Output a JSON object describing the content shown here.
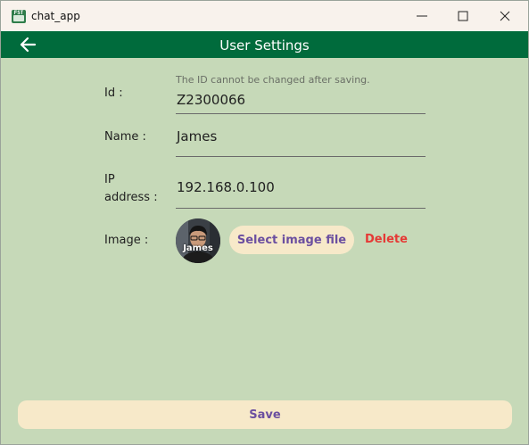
{
  "window": {
    "title": "chat_app",
    "app_icon_text": "FST"
  },
  "appbar": {
    "title": "User Settings",
    "back_icon": "arrow-left-icon"
  },
  "form": {
    "id": {
      "label": "Id :",
      "helper": "The ID cannot be changed after saving.",
      "value": "Z2300066"
    },
    "name": {
      "label": "Name :",
      "value": "James"
    },
    "ip": {
      "label_line1": "IP",
      "label_line2": "address :",
      "value": "192.168.0.100"
    },
    "image": {
      "label": "Image :",
      "avatar_caption": "James",
      "select_button": "Select image file",
      "delete_button": "Delete"
    }
  },
  "footer": {
    "save_button": "Save"
  },
  "colors": {
    "appbar": "#006b3c",
    "background": "#c6d9b8",
    "button_bg": "#f7e9c9",
    "button_text": "#6b4fa0",
    "delete_text": "#e53935"
  }
}
